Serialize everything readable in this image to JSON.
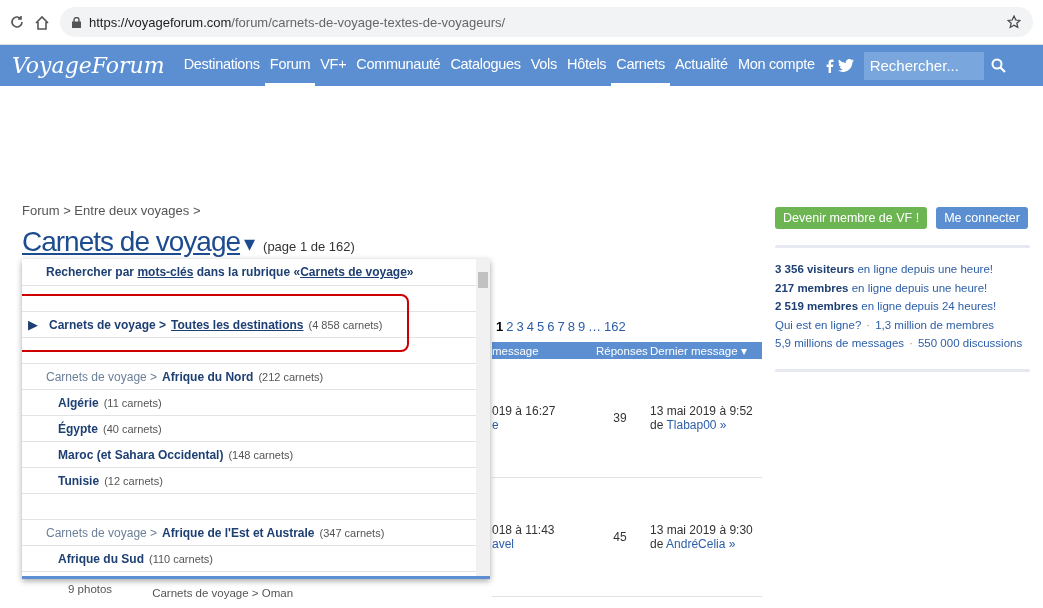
{
  "browser": {
    "url_host": "https://voyageforum.com",
    "url_path": "/forum/carnets-de-voyage-textes-de-voyageurs/"
  },
  "nav": {
    "logo": "VoyageForum",
    "items": [
      {
        "label": "Destinations",
        "selected": false
      },
      {
        "label": "Forum",
        "selected": true
      },
      {
        "label": "VF+",
        "selected": false
      },
      {
        "label": "Communauté",
        "selected": false
      },
      {
        "label": "Catalogues",
        "selected": false
      },
      {
        "label": "Vols",
        "selected": false
      },
      {
        "label": "Hôtels",
        "selected": false
      },
      {
        "label": "Carnets",
        "selected": true
      },
      {
        "label": "Actualité",
        "selected": false
      },
      {
        "label": "Mon compte",
        "selected": false
      }
    ],
    "search": {
      "placeholder": "Rechercher..."
    }
  },
  "breadcrumb": "Forum > Entre deux voyages >",
  "title": "Carnets de voyage",
  "title_caret": "▾",
  "page_info": "(page 1 de 162)",
  "pagination": [
    {
      "label": "1",
      "selected": true
    },
    {
      "label": "2",
      "selected": false
    },
    {
      "label": "3",
      "selected": false
    },
    {
      "label": "4",
      "selected": false
    },
    {
      "label": "5",
      "selected": false
    },
    {
      "label": "6",
      "selected": false
    },
    {
      "label": "7",
      "selected": false
    },
    {
      "label": "8",
      "selected": false
    },
    {
      "label": "9",
      "selected": false
    },
    {
      "label": "…",
      "selected": false
    },
    {
      "label": "162",
      "selected": false
    }
  ],
  "table": {
    "columns": [
      "message",
      "Réponses",
      "Dernier message"
    ],
    "sort_caret": "▾",
    "rows": [
      {
        "first": "019 à 16:27",
        "first_by": "e",
        "replies": "39",
        "last": "13 mai 2019 à 9:52",
        "last_prefix": "de",
        "last_by": "Tlabap00 »"
      },
      {
        "first": "018 à 11:43",
        "first_by": "avel",
        "replies": "45",
        "last": "13 mai 2019 à 9:30",
        "last_prefix": "de",
        "last_by": "AndréCelia »"
      }
    ]
  },
  "listing_footer": {
    "photos": "9 photos",
    "path": "Carnets de voyage > Oman"
  },
  "dropdown": {
    "search": {
      "before": "Rechercher par",
      "link": "mots-clés",
      "middle": "dans la rubrique «",
      "link_2": "Carnets de voyage",
      "after": "»"
    },
    "items": [
      {
        "kind": "current",
        "arrow": "▶",
        "prefix": "Carnets de voyage >",
        "name": "Toutes les destinations",
        "count": "(4 858 carnets)",
        "selected": true,
        "highlighted": true
      },
      {
        "kind": "section",
        "prefix": "Carnets de voyage >",
        "name": "Afrique du Nord",
        "count": "(212 carnets)",
        "selected": false
      },
      {
        "kind": "sub",
        "name": "Algérie",
        "count": "(11 carnets)",
        "selected": false
      },
      {
        "kind": "sub",
        "name": "Égypte",
        "count": "(40 carnets)",
        "selected": false
      },
      {
        "kind": "sub",
        "name": "Maroc (et Sahara Occidental)",
        "count": "(148 carnets)",
        "selected": false
      },
      {
        "kind": "sub",
        "name": "Tunisie",
        "count": "(12 carnets)",
        "selected": false
      },
      {
        "kind": "section",
        "prefix": "Carnets de voyage >",
        "name": "Afrique de l'Est et Australe",
        "count": "(347 carnets)",
        "selected": false
      },
      {
        "kind": "sub",
        "name": "Afrique du Sud",
        "count": "(110 carnets)",
        "selected": false
      }
    ]
  },
  "sidebar": {
    "join_button": "Devenir membre de VF !",
    "login_button": "Me connecter",
    "stats": [
      "**3 356 visiteurs** en ligne depuis une heure!",
      "**217 membres** en ligne depuis une heure!",
      "**2 519 membres** en ligne depuis 24 heures!"
    ],
    "links": [
      {
        "first": "Qui est en ligne?",
        "separator": "·",
        "second": "1,3 million de membres"
      },
      {
        "first": "5,9 millions de messages",
        "separator": "·",
        "second": "550 000 discussions"
      }
    ]
  }
}
